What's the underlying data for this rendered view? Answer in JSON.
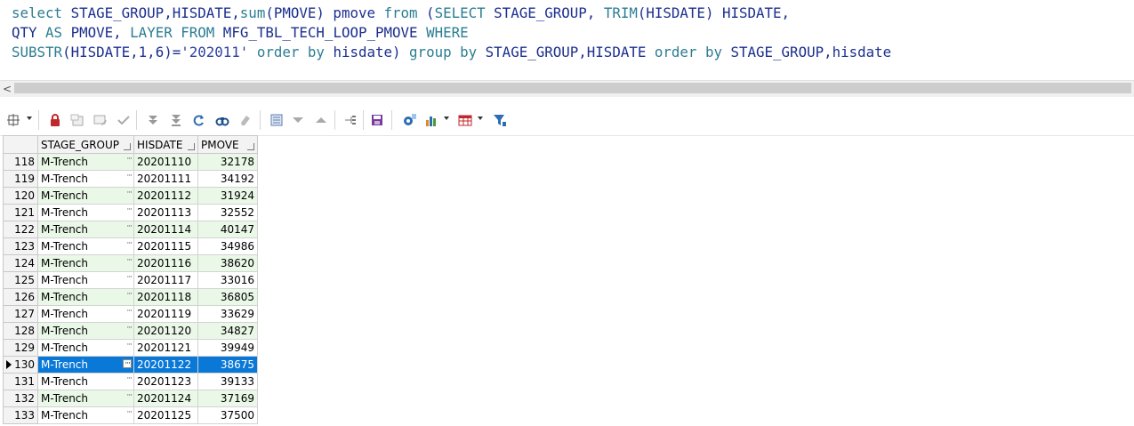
{
  "editor": {
    "line1": {
      "a": "select ",
      "b": "STAGE_GROUP,HISDATE,",
      "c": "sum",
      "d": "(PMOVE) pmove ",
      "e": "from",
      "f": " (",
      "g": "SELECT",
      "h": " STAGE_GROUP, ",
      "i": "TRIM",
      "j": "(HISDATE) HISDATE,"
    },
    "line2": {
      "a": "QTY ",
      "b": "AS",
      "c": " PMOVE, ",
      "d": "LAYER",
      "e": " ",
      "f": "FROM",
      "g": " MFG_TBL_TECH_LOOP_PMOVE ",
      "h": "WHERE"
    },
    "line3": {
      "a": "SUBSTR",
      "b": "(HISDATE,1,6)=",
      "c": "'202011'",
      "d": " order by ",
      "e": "hisdate) ",
      "f": "group by ",
      "g": "STAGE_GROUP,HISDATE ",
      "h": "order by ",
      "i": "STAGE_GROUP,hisdate"
    }
  },
  "scrollbar": {
    "left_arrow": "<"
  },
  "grid": {
    "columns": [
      "STAGE_GROUP",
      "HISDATE",
      "PMOVE"
    ],
    "selected_row": 130,
    "rows": [
      {
        "n": "118",
        "stage": "M-Trench",
        "date": "20201110",
        "pmove": "32178"
      },
      {
        "n": "119",
        "stage": "M-Trench",
        "date": "20201111",
        "pmove": "34192"
      },
      {
        "n": "120",
        "stage": "M-Trench",
        "date": "20201112",
        "pmove": "31924"
      },
      {
        "n": "121",
        "stage": "M-Trench",
        "date": "20201113",
        "pmove": "32552"
      },
      {
        "n": "122",
        "stage": "M-Trench",
        "date": "20201114",
        "pmove": "40147"
      },
      {
        "n": "123",
        "stage": "M-Trench",
        "date": "20201115",
        "pmove": "34986"
      },
      {
        "n": "124",
        "stage": "M-Trench",
        "date": "20201116",
        "pmove": "38620"
      },
      {
        "n": "125",
        "stage": "M-Trench",
        "date": "20201117",
        "pmove": "33016"
      },
      {
        "n": "126",
        "stage": "M-Trench",
        "date": "20201118",
        "pmove": "36805"
      },
      {
        "n": "127",
        "stage": "M-Trench",
        "date": "20201119",
        "pmove": "33629"
      },
      {
        "n": "128",
        "stage": "M-Trench",
        "date": "20201120",
        "pmove": "34827"
      },
      {
        "n": "129",
        "stage": "M-Trench",
        "date": "20201121",
        "pmove": "39949"
      },
      {
        "n": "130",
        "stage": "M-Trench",
        "date": "20201122",
        "pmove": "38675"
      },
      {
        "n": "131",
        "stage": "M-Trench",
        "date": "20201123",
        "pmove": "39133"
      },
      {
        "n": "132",
        "stage": "M-Trench",
        "date": "20201124",
        "pmove": "37169"
      },
      {
        "n": "133",
        "stage": "M-Trench",
        "date": "20201125",
        "pmove": "37500"
      }
    ]
  },
  "colors": {
    "selection": "#0a78d7",
    "alt_row": "#eaf8e8",
    "keyword": "#2b7d93",
    "identifier": "#1c2f8f"
  },
  "toolbar_icons": [
    "grid-options-icon",
    "lock-icon",
    "add-record-icon",
    "edit-record-icon",
    "post-edit-icon",
    "first-record-icon",
    "last-record-icon",
    "refresh-icon",
    "find-icon",
    "clear-icon",
    "record-view-icon",
    "prior-icon",
    "next-icon",
    "tree-icon",
    "save-icon",
    "export-icon",
    "chart-icon",
    "table-icon",
    "filter-icon"
  ]
}
